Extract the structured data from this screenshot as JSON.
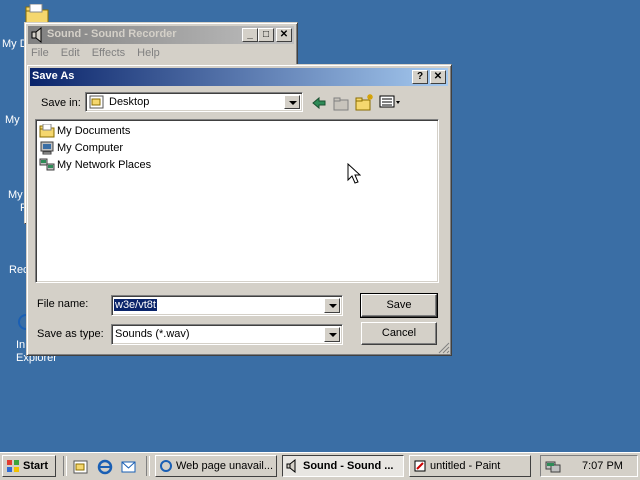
{
  "desktop": {
    "icons": [
      {
        "name": "my-documents-desktop-icon",
        "label": "My D"
      },
      {
        "name": "my-computer-desktop-icon",
        "label": "My"
      },
      {
        "name": "my-network-desktop-icon",
        "label": "My"
      },
      {
        "name": "my-network-desktop-icon-line2",
        "label": "P"
      },
      {
        "name": "recycle-bin-desktop-icon",
        "label": "Rec"
      },
      {
        "name": "ie-desktop-icon",
        "label": "In"
      },
      {
        "name": "ie-desktop-icon-line2",
        "label": "Explorer"
      }
    ]
  },
  "sound_recorder": {
    "title": "Sound - Sound Recorder",
    "menu": [
      "File",
      "Edit",
      "Effects",
      "Help"
    ]
  },
  "save_dialog": {
    "title": "Save As",
    "save_in_label": "Save in:",
    "save_in_value": "Desktop",
    "files": [
      "My Documents",
      "My Computer",
      "My Network Places"
    ],
    "file_name_label": "File name:",
    "file_name_value": "w3e/vt8t",
    "save_as_type_label": "Save as type:",
    "save_as_type_value": "Sounds (*.wav)",
    "save_button": "Save",
    "cancel_button": "Cancel"
  },
  "taskbar": {
    "start": "Start",
    "tasks": [
      "Web page unavail...",
      "Sound - Sound ...",
      "untitled - Paint"
    ],
    "clock": "7:07 PM"
  },
  "colors": {
    "desktop": "#3a6ea5",
    "title_active": "#0a246a",
    "title_inactive": "#808080",
    "face": "#d4d0c8",
    "selection": "#0a246a"
  }
}
